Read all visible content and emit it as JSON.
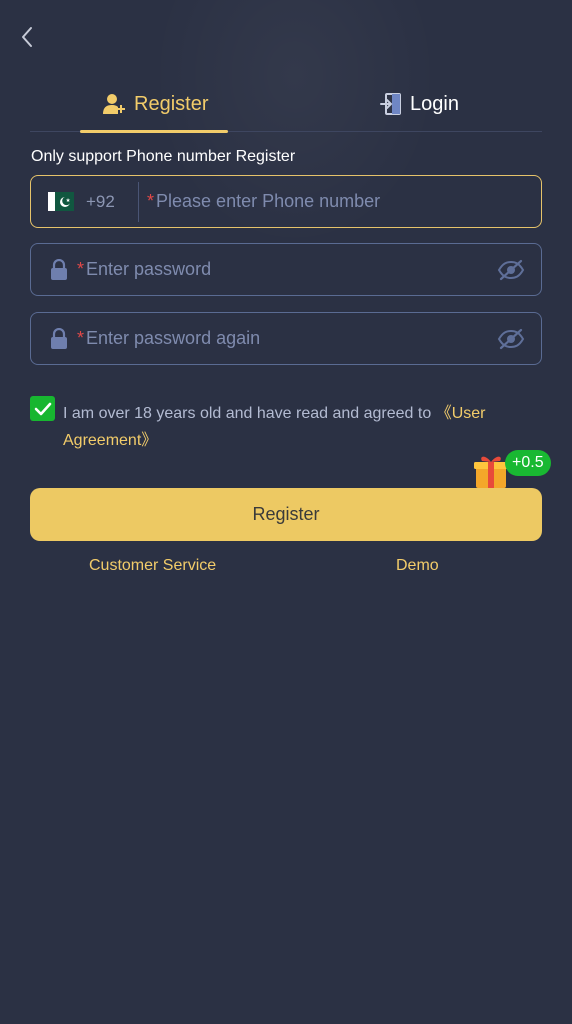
{
  "tabs": {
    "register_label": "Register",
    "login_label": "Login"
  },
  "hint": "Only support Phone number Register",
  "phone": {
    "country_code": "+92",
    "required_mark": "*",
    "placeholder": "Please enter Phone number"
  },
  "password": {
    "required_mark": "*",
    "placeholder": "Enter password"
  },
  "password_again": {
    "required_mark": "*",
    "placeholder": "Enter password again"
  },
  "agreement": {
    "checked": true,
    "text": "I am over 18 years old and have read and agreed to ",
    "link": "《User Agreement》"
  },
  "reward": {
    "badge": "+0.5"
  },
  "register_button": "Register",
  "footer": {
    "customer_service": "Customer Service",
    "demo": "Demo"
  },
  "colors": {
    "background": "#2b3144",
    "accent": "#f2cc6a",
    "button": "#edc963",
    "success": "#17b630"
  },
  "icons": {
    "back": "back-chevron-icon",
    "register_tab": "add-user-icon",
    "login_tab": "login-door-icon",
    "flag": "pakistan-flag-icon",
    "lock": "lock-icon",
    "eye": "eye-off-icon",
    "checkbox": "check-icon",
    "gift": "gift-icon"
  }
}
